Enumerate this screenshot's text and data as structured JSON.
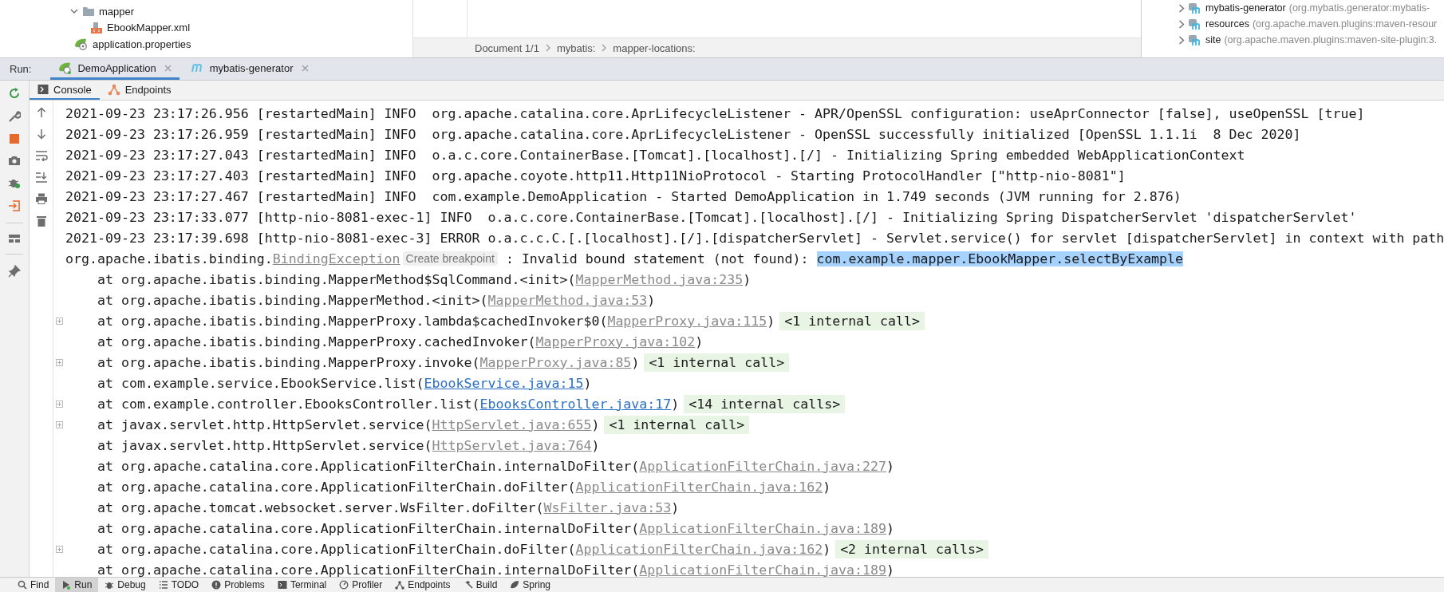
{
  "project_tree": [
    {
      "label": "mapper",
      "kind": "folder",
      "expanded": true,
      "children": [
        {
          "label": "EbookMapper.xml",
          "kind": "xml"
        }
      ]
    },
    {
      "label": "application.properties",
      "kind": "properties"
    }
  ],
  "breadcrumb": [
    "Document 1/1",
    "mybatis:",
    "mapper-locations:"
  ],
  "maven_plugins": [
    {
      "name": "mybatis-generator",
      "detail": "(org.mybatis.generator:mybatis-"
    },
    {
      "name": "resources",
      "detail": "(org.apache.maven.plugins:maven-resour"
    },
    {
      "name": "site",
      "detail": "(org.apache.maven.plugins:maven-site-plugin:3."
    }
  ],
  "run_bar": {
    "label": "Run:",
    "tabs": [
      {
        "label": "DemoApplication",
        "kind": "spring",
        "selected": true
      },
      {
        "label": "mybatis-generator",
        "kind": "maven",
        "selected": false
      }
    ]
  },
  "console_tabs": [
    {
      "label": "Console",
      "kind": "console",
      "selected": true
    },
    {
      "label": "Endpoints",
      "kind": "endpoints",
      "selected": false
    }
  ],
  "console_lines": [
    {
      "kind": "log",
      "text": "2021-09-23 23:17:26.956 [restartedMain] INFO  org.apache.catalina.core.AprLifecycleListener - APR/OpenSSL configuration: useAprConnector [false], useOpenSSL [true]"
    },
    {
      "kind": "log",
      "text": "2021-09-23 23:17:26.959 [restartedMain] INFO  org.apache.catalina.core.AprLifecycleListener - OpenSSL successfully initialized [OpenSSL 1.1.1i  8 Dec 2020]"
    },
    {
      "kind": "log",
      "text": "2021-09-23 23:17:27.043 [restartedMain] INFO  o.a.c.core.ContainerBase.[Tomcat].[localhost].[/] - Initializing Spring embedded WebApplicationContext"
    },
    {
      "kind": "log",
      "text": "2021-09-23 23:17:27.403 [restartedMain] INFO  org.apache.coyote.http11.Http11NioProtocol - Starting ProtocolHandler [\"http-nio-8081\"]"
    },
    {
      "kind": "log",
      "text": "2021-09-23 23:17:27.467 [restartedMain] INFO  com.example.DemoApplication - Started DemoApplication in 1.749 seconds (JVM running for 2.876)"
    },
    {
      "kind": "log",
      "text": "2021-09-23 23:17:33.077 [http-nio-8081-exec-1] INFO  o.a.c.core.ContainerBase.[Tomcat].[localhost].[/] - Initializing Spring DispatcherServlet 'dispatcherServlet'"
    },
    {
      "kind": "log",
      "text": "2021-09-23 23:17:39.698 [http-nio-8081-exec-3] ERROR o.a.c.c.C.[.[localhost].[/].[dispatcherServlet] - Servlet.service() for servlet [dispatcherServlet] in context with path"
    },
    {
      "kind": "exception",
      "prefix": "org.apache.ibatis.binding.",
      "link": "BindingException",
      "hint": "Create breakpoint",
      "message": " : Invalid bound statement (not found): ",
      "selection": "com.example.mapper.EbookMapper.selectByExample"
    },
    {
      "kind": "frame",
      "text": "at org.apache.ibatis.binding.MapperMethod$SqlCommand.<init>(",
      "link": "MapperMethod.java:235",
      "in_project": false,
      "close": ")"
    },
    {
      "kind": "frame",
      "text": "at org.apache.ibatis.binding.MapperMethod.<init>(",
      "link": "MapperMethod.java:53",
      "in_project": false,
      "close": ")"
    },
    {
      "kind": "frame",
      "text": "at org.apache.ibatis.binding.MapperProxy.lambda$cachedInvoker$0(",
      "link": "MapperProxy.java:115",
      "in_project": false,
      "close": ")",
      "internal": "<1 internal call>"
    },
    {
      "kind": "frame",
      "text": "at org.apache.ibatis.binding.MapperProxy.cachedInvoker(",
      "link": "MapperProxy.java:102",
      "in_project": false,
      "close": ")"
    },
    {
      "kind": "frame",
      "text": "at org.apache.ibatis.binding.MapperProxy.invoke(",
      "link": "MapperProxy.java:85",
      "in_project": false,
      "close": ")",
      "internal": "<1 internal call>"
    },
    {
      "kind": "frame",
      "text": "at com.example.service.EbookService.list(",
      "link": "EbookService.java:15",
      "in_project": true,
      "close": ")"
    },
    {
      "kind": "frame",
      "text": "at com.example.controller.EbooksController.list(",
      "link": "EbooksController.java:17",
      "in_project": true,
      "close": ")",
      "internal": "<14 internal calls>"
    },
    {
      "kind": "frame",
      "text": "at javax.servlet.http.HttpServlet.service(",
      "link": "HttpServlet.java:655",
      "in_project": false,
      "close": ")",
      "internal": "<1 internal call>"
    },
    {
      "kind": "frame",
      "text": "at javax.servlet.http.HttpServlet.service(",
      "link": "HttpServlet.java:764",
      "in_project": false,
      "close": ")"
    },
    {
      "kind": "frame",
      "text": "at org.apache.catalina.core.ApplicationFilterChain.internalDoFilter(",
      "link": "ApplicationFilterChain.java:227",
      "in_project": false,
      "close": ")"
    },
    {
      "kind": "frame",
      "text": "at org.apache.catalina.core.ApplicationFilterChain.doFilter(",
      "link": "ApplicationFilterChain.java:162",
      "in_project": false,
      "close": ")"
    },
    {
      "kind": "frame",
      "text": "at org.apache.tomcat.websocket.server.WsFilter.doFilter(",
      "link": "WsFilter.java:53",
      "in_project": false,
      "close": ")"
    },
    {
      "kind": "frame",
      "text": "at org.apache.catalina.core.ApplicationFilterChain.internalDoFilter(",
      "link": "ApplicationFilterChain.java:189",
      "in_project": false,
      "close": ")"
    },
    {
      "kind": "frame",
      "text": "at org.apache.catalina.core.ApplicationFilterChain.doFilter(",
      "link": "ApplicationFilterChain.java:162",
      "in_project": false,
      "close": ")",
      "internal": "<2 internal calls>"
    },
    {
      "kind": "frame",
      "text": "at org.apache.catalina.core.ApplicationFilterChain.internalDoFilter(",
      "link": "ApplicationFilterChain.java:189",
      "in_project": false,
      "close": ")"
    }
  ],
  "bottom_bar": [
    {
      "label": "Find",
      "selected": false
    },
    {
      "label": "Run",
      "selected": true
    },
    {
      "label": "Debug",
      "selected": false
    },
    {
      "label": "TODO",
      "selected": false
    },
    {
      "label": "Problems",
      "selected": false
    },
    {
      "label": "Terminal",
      "selected": false
    },
    {
      "label": "Profiler",
      "selected": false
    },
    {
      "label": "Endpoints",
      "selected": false
    },
    {
      "label": "Build",
      "selected": false
    },
    {
      "label": "Spring",
      "selected": false
    }
  ]
}
